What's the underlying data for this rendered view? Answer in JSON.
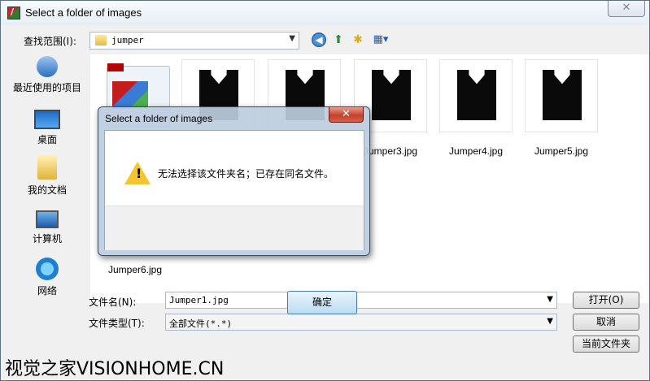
{
  "window": {
    "title": "Select a folder of images",
    "close_glyph": "✕"
  },
  "toolbar": {
    "look_in_label": "查找范围(I):",
    "look_in_value": "jumper"
  },
  "places": [
    {
      "label": "最近使用的项目",
      "icon": "recent-items-icon"
    },
    {
      "label": "桌面",
      "icon": "desktop-icon"
    },
    {
      "label": "我的文档",
      "icon": "documents-icon"
    },
    {
      "label": "计算机",
      "icon": "computer-icon"
    },
    {
      "label": "网络",
      "icon": "network-icon"
    }
  ],
  "files": [
    {
      "name": ""
    },
    {
      "name": ""
    },
    {
      "name": ""
    },
    {
      "name": "Jumper3.jpg"
    },
    {
      "name": "Jumper4.jpg"
    },
    {
      "name": "Jumper5.jpg"
    },
    {
      "name": "Jumper6.jpg"
    }
  ],
  "bottom": {
    "filename_label": "文件名(N):",
    "filename_value": "Jumper1.jpg",
    "filetype_label": "文件类型(T):",
    "filetype_value": "全部文件(*.*)",
    "open_label": "打开(O)",
    "cancel_label": "取消",
    "current_folder_label": "当前文件夹"
  },
  "dialog": {
    "title": "Select a folder of images",
    "message": "无法选择该文件夹名；已存在同名文件。",
    "ok_label": "确定",
    "close_glyph": "✕",
    "warning_glyph": "!"
  },
  "watermark": "视觉之家VISIONHOME.CN"
}
